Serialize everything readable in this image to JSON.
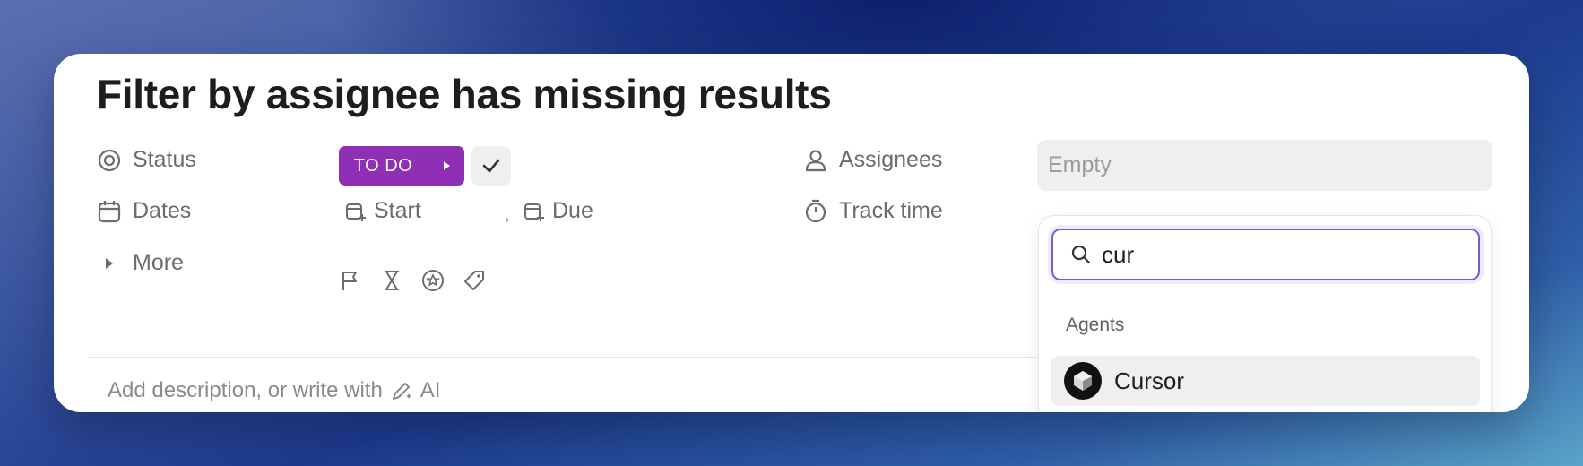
{
  "task": {
    "title": "Filter by assignee has missing results"
  },
  "fields": {
    "status_label": "Status",
    "status_value": "TO DO",
    "dates_label": "Dates",
    "start_label": "Start",
    "due_label": "Due",
    "date_arrow": "→",
    "more_label": "More",
    "assignees_label": "Assignees",
    "assignees_placeholder": "Empty",
    "track_time_label": "Track time"
  },
  "description": {
    "placeholder": "Add description, or write with",
    "ai_label": "AI"
  },
  "assignee_dropdown": {
    "search_value": "cur",
    "group_label": "Agents",
    "options": [
      {
        "label": "Cursor",
        "icon": "cursor-logo-icon"
      }
    ]
  },
  "colors": {
    "status_purple": "#8f2fb5",
    "focus_ring": "#7b5cd6"
  },
  "icons": [
    "status-icon",
    "calendar-icon",
    "caret-right-icon",
    "person-icon",
    "timer-icon",
    "flag-icon",
    "hourglass-icon",
    "star-badge-icon",
    "tag-icon",
    "ai-pencil-icon",
    "search-icon",
    "check-icon"
  ]
}
